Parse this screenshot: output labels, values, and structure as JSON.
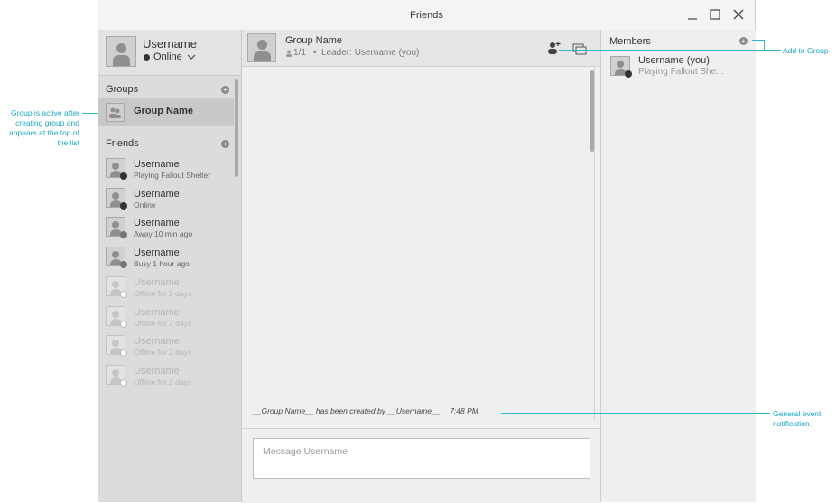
{
  "window": {
    "title": "Friends"
  },
  "profile": {
    "username": "Username",
    "status": "Online"
  },
  "groups": {
    "title": "Groups",
    "items": [
      {
        "name": "Group Name"
      }
    ]
  },
  "friends": {
    "title": "Friends",
    "items": [
      {
        "name": "Username",
        "status": "Playing Fallout Shelter",
        "presence": "online"
      },
      {
        "name": "Username",
        "status": "Online",
        "presence": "online"
      },
      {
        "name": "Username",
        "status": "Away 10 min ago",
        "presence": "away"
      },
      {
        "name": "Username",
        "status": "Busy 1 hour ago",
        "presence": "busy"
      },
      {
        "name": "Username",
        "status": "Offline for 2 days",
        "presence": "offline"
      },
      {
        "name": "Username",
        "status": "Offline for 2 days",
        "presence": "offline"
      },
      {
        "name": "Username",
        "status": "Offline for 2 days",
        "presence": "offline"
      },
      {
        "name": "Username",
        "status": "Offline for 2 days",
        "presence": "offline"
      }
    ]
  },
  "chat": {
    "group_name": "Group Name",
    "member_count": "1/1",
    "leader": "Leader: Username (you)",
    "event_message": "__Group Name__ has been created by __Username__.",
    "event_time": "7:48 PM",
    "input_placeholder": "Message Username"
  },
  "members": {
    "title": "Members",
    "items": [
      {
        "name": "Username (you)",
        "status": "Playing Fallout She..."
      }
    ]
  },
  "annotations": {
    "add_to_group": "Add to Group",
    "group_active": "Group is active after creating group and appears at the top of the list",
    "event_notification": "General event notification."
  },
  "colors": {
    "accent": "#1aa7c4",
    "online": "#333333",
    "away": "#777777",
    "offline": "#ffffff"
  }
}
